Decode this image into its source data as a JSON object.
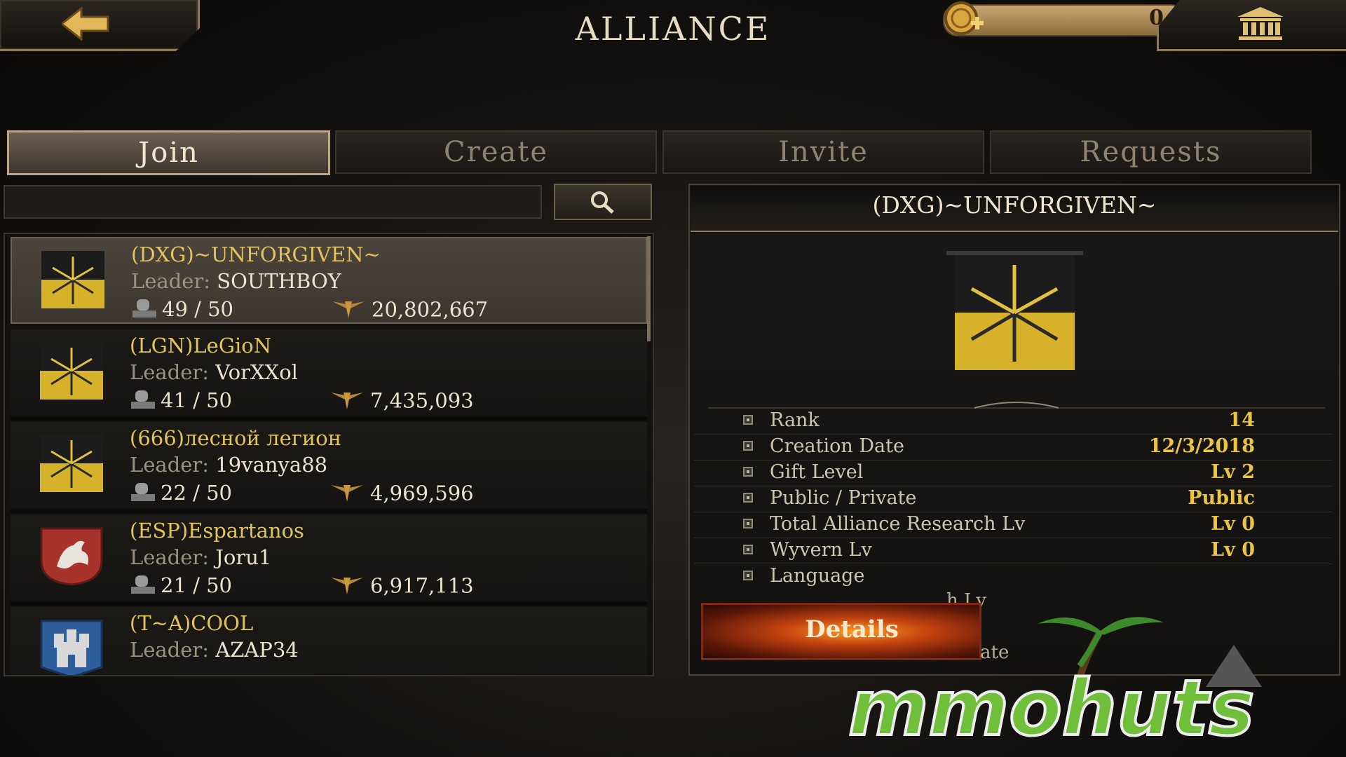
{
  "header": {
    "title": "ALLIANCE",
    "gold_amount": "0",
    "back_icon": "back-arrow-icon",
    "bank_icon": "bank-icon"
  },
  "tabs": [
    {
      "label": "Join",
      "active": true
    },
    {
      "label": "Create",
      "active": false
    },
    {
      "label": "Invite",
      "active": false
    },
    {
      "label": "Requests",
      "active": false
    }
  ],
  "search": {
    "value": "",
    "icon": "search-icon"
  },
  "alliances": [
    {
      "name": "(DXG)~UNFORGIVEN~",
      "leader_label": "Leader:",
      "leader": "SOUTHBOY",
      "members": "49 / 50",
      "power": "20,802,667",
      "crest": "yellow-black-swords"
    },
    {
      "name": "(LGN)LeGioN",
      "leader_label": "Leader:",
      "leader": "VorXXol",
      "members": "41 / 50",
      "power": "7,435,093",
      "crest": "yellow-black-swords"
    },
    {
      "name": "(666)лесной легион",
      "leader_label": "Leader:",
      "leader": "19vanya88",
      "members": "22 / 50",
      "power": "4,969,596",
      "crest": "yellow-black-swords"
    },
    {
      "name": "(ESP)Espartanos",
      "leader_label": "Leader:",
      "leader": "Joru1",
      "members": "21 / 50",
      "power": "6,917,113",
      "crest": "red-dragon"
    },
    {
      "name": "(T~A)COOL",
      "leader_label": "Leader:",
      "leader": "AZAP34",
      "members": "",
      "power": "",
      "crest": "blue-castle"
    }
  ],
  "detail": {
    "title": "(DXG)~UNFORGIVEN~",
    "rows": [
      {
        "label": "Rank",
        "value": "14"
      },
      {
        "label": "Creation Date",
        "value": "12/3/2018"
      },
      {
        "label": "Gift Level",
        "value": "Lv 2"
      },
      {
        "label": "Public / Private",
        "value": "Public"
      },
      {
        "label": "Total Alliance Research Lv",
        "value": "Lv 0"
      },
      {
        "label": "Wyvern Lv",
        "value": "Lv 0"
      },
      {
        "label": "Language",
        "value": ""
      }
    ],
    "partial_text_1": "h Lv",
    "partial_text_2": "ate",
    "details_button": "Details"
  },
  "colors": {
    "accent_gold": "#e2c45a",
    "value_yellow": "#ecc53e",
    "button_orange": "#c2420f"
  }
}
